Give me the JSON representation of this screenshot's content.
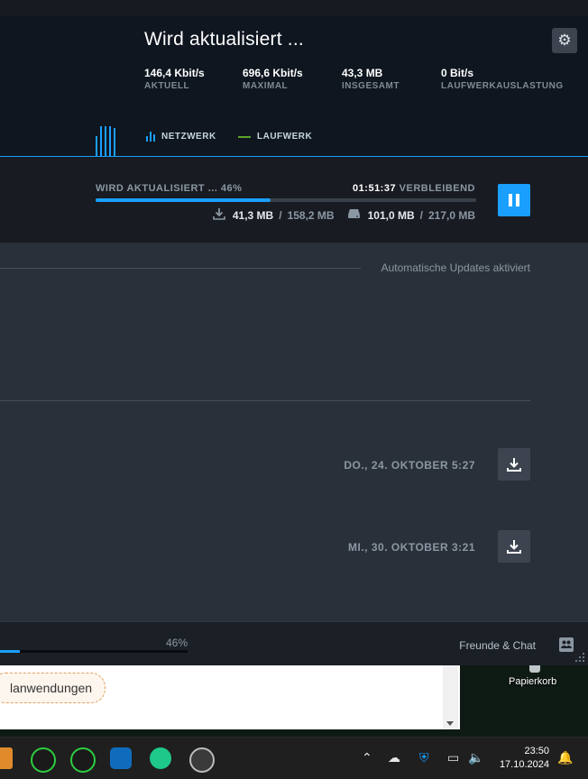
{
  "header": {
    "game_title": "Wird aktualisiert ...",
    "stats": [
      {
        "value": "146,4 Kbit/s",
        "label": "AKTUELL"
      },
      {
        "value": "696,6 Kbit/s",
        "label": "MAXIMAL"
      },
      {
        "value": "43,3 MB",
        "label": "INSGESAMT"
      },
      {
        "value": "0 Bit/s",
        "label": "LAUFWERKAUSLASTUNG"
      }
    ],
    "legend": {
      "network": "NETZWERK",
      "disk": "LAUFWERK"
    },
    "icons": {
      "settings": "gear-icon"
    }
  },
  "active_download": {
    "status_label": "WIRD AKTUALISIERT ... 46%",
    "progress_percent": 46,
    "time_remaining": "01:51:37",
    "remaining_label": "VERBLEIBEND",
    "downloaded": "41,3 MB",
    "download_total": "158,2 MB",
    "disk_written": "101,0 MB",
    "disk_total": "217,0 MB",
    "separator": "/"
  },
  "queue": {
    "auto_updates_label": "Automatische Updates aktiviert",
    "scheduled": [
      {
        "date": "DO., 24. OKTOBER 5:27"
      },
      {
        "date": "MI., 30. OKTOBER 3:21"
      }
    ]
  },
  "footer": {
    "progress_percent_label": "46%",
    "progress_percent": 46,
    "friends_label": "Freunde & Chat"
  },
  "background_window": {
    "pill_text": "lanwendungen"
  },
  "desktop": {
    "recycle_bin_label": "Papierkorb"
  },
  "taskbar": {
    "time": "23:50",
    "date": "17.10.2024"
  },
  "colors": {
    "accent": "#1a9fff",
    "disk_line": "#5ba32b"
  }
}
